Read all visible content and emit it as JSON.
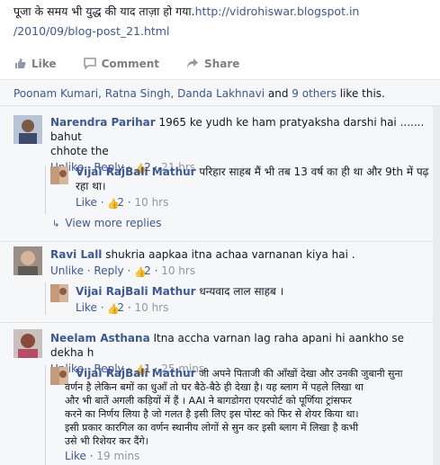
{
  "post": {
    "text_line1": "पूजा के समय भी युद्ध की याद ताज़ा हो गया.",
    "url_part1": "http://vidrohiswar.blogspot.in",
    "url_part2": "/2010/09/blog-post_21.html"
  },
  "actions": {
    "like": "Like",
    "comment": "Comment",
    "share": "Share"
  },
  "likes": {
    "names": "Poonam Kumari, Ratna Singh, Danda Lakhnavi",
    "and": " and ",
    "others": "9 others",
    "tail": " like this."
  },
  "comments": [
    {
      "author": "Narendra Parihar",
      "text_a": "1965 ke yudh ke ham pratyaksha darshi hai ....... bahut",
      "text_b": "chhote the",
      "unlike": "Unlike",
      "reply": "Reply",
      "likes": "2",
      "time": "21 hrs",
      "replies": [
        {
          "author": "Vijai RajBali Mathur",
          "text_a": "परिहार साहब मैं भी तब 13 वर्ष का ही था और 9th में पढ़",
          "text_b": "रहा था।",
          "like": "Like",
          "likes": "2",
          "time": "10 hrs"
        }
      ],
      "view_more": "View more replies"
    },
    {
      "author": "Ravi Lall",
      "text_a": "shukria aapkaa itna achaa varnanan kiya hai .",
      "unlike": "Unlike",
      "reply": "Reply",
      "likes": "2",
      "time": "10 hrs",
      "replies": [
        {
          "author": "Vijai RajBali Mathur",
          "text_a": "धन्यवाद लाल साहब ।",
          "like": "Like",
          "likes": "2",
          "time": "10 hrs"
        }
      ]
    },
    {
      "author": "Neelam Asthana",
      "text_a": "Itna accha varnan lag raha apani hi aankho se dekha h",
      "unlike": "Unlike",
      "reply": "Reply",
      "likes": "1",
      "time": "25 mins",
      "replies": [
        {
          "author": "Vijai RajBali Mathur",
          "text_a": "जी अपने पिताजी की आँखों देखा और उनकी जुबानी सुना",
          "text_b": "वर्णन है लेकिन बमों का धुआँ तो घर बैठे-बैठे ही देखा है। यह ब्लाग में पहले लिखा था",
          "text_c": "और भी बातें अगली कड़ियों में हैं । AAI ने बागडोगरा एयरपोर्ट को पूर्णिया ट्रांसफर",
          "text_d": "करने का निर्णय लिया है जो गलत है इसी लिए इस पोस्ट को फिर से शेयर किया था।",
          "text_e": "इसी प्रकार कारगिल का वर्णन स्थानीय लोगों से सुन कर इसी ब्लाग में लिखा है कभी",
          "text_f": "उसे भी रिशेयर कर दैंगे।",
          "like": "Like",
          "time": "19 mins"
        }
      ]
    }
  ],
  "colors": {
    "link": "#3b5998",
    "muted": "#9197a3",
    "comment_bg": "#f6f7f9"
  }
}
